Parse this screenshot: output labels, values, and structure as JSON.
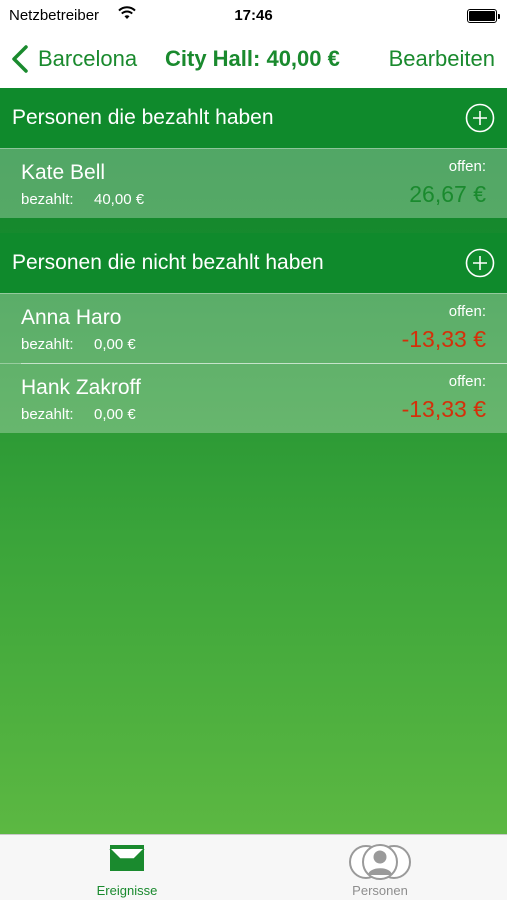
{
  "status_bar": {
    "carrier": "Netzbetreiber",
    "time": "17:46"
  },
  "nav": {
    "back_label": "Barcelona",
    "title": "City Hall: 40,00 €",
    "edit_label": "Bearbeiten"
  },
  "paid_section": {
    "header": "Personen die bezahlt haben",
    "rows": [
      {
        "name": "Kate Bell",
        "paid_label": "bezahlt:",
        "paid_value": "40,00 €",
        "open_label": "offen:",
        "open_value": "26,67 €"
      }
    ]
  },
  "unpaid_section": {
    "header": "Personen die nicht bezahlt haben",
    "rows": [
      {
        "name": "Anna Haro",
        "paid_label": "bezahlt:",
        "paid_value": "0,00 €",
        "open_label": "offen:",
        "open_value": "-13,33 €"
      },
      {
        "name": "Hank Zakroff",
        "paid_label": "bezahlt:",
        "paid_value": "0,00 €",
        "open_label": "offen:",
        "open_value": "-13,33 €"
      }
    ]
  },
  "tabs": [
    {
      "label": "Ereignisse",
      "icon": "inbox-tray-icon",
      "active": true
    },
    {
      "label": "Personen",
      "icon": "people-group-icon",
      "active": false
    }
  ],
  "colors": {
    "accent": "#1a8a2e",
    "negative": "#d4300a",
    "header_green": "#0f8a2c"
  }
}
